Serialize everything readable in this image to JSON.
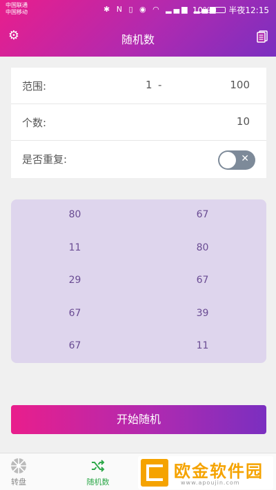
{
  "status_bar": {
    "carrier1": "中国联通",
    "carrier2": "中国移动",
    "battery": "10%",
    "time": "半夜12:15"
  },
  "header": {
    "title": "随机数",
    "settings_icon": "gear-icon",
    "history_icon": "documents-icon"
  },
  "settings": {
    "range_label": "范围:",
    "range_min": "1",
    "range_sep": "-",
    "range_max": "100",
    "count_label": "个数:",
    "count_value": "10",
    "repeat_label": "是否重复:",
    "repeat_enabled": false,
    "repeat_off_mark": "✕"
  },
  "results": [
    "80",
    "67",
    "11",
    "80",
    "29",
    "67",
    "67",
    "39",
    "67",
    "11"
  ],
  "actions": {
    "start_label": "开始随机"
  },
  "bottom_nav": [
    {
      "label": "转盘",
      "icon": "wheel-icon"
    },
    {
      "label": "随机数",
      "icon": "shuffle-icon",
      "active": true
    }
  ],
  "watermark": {
    "text": "欧金软件园",
    "url": "www.apoujin.com"
  },
  "colors": {
    "accent_start": "#e91e8c",
    "accent_end": "#7b2fc0",
    "result_text": "#6a4c93",
    "nav_active": "#2ea84a"
  }
}
